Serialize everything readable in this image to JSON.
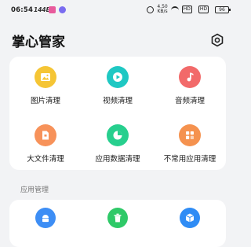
{
  "status_bar": {
    "time": "06:54",
    "net_speed": "144B",
    "net_rate_top": "4.50",
    "net_rate_bottom": "KB/s",
    "battery": "96"
  },
  "header": {
    "title": "掌心管家"
  },
  "tools": [
    {
      "label": "图片清理",
      "color": "#f5c535",
      "icon": "image-icon"
    },
    {
      "label": "视频清理",
      "color": "#1fc8c3",
      "icon": "play-icon"
    },
    {
      "label": "音频清理",
      "color": "#f26a6a",
      "icon": "music-note-icon"
    },
    {
      "label": "大文件清理",
      "color": "#f7925a",
      "icon": "file-icon"
    },
    {
      "label": "应用数据清理",
      "color": "#27cf8e",
      "icon": "pie-chart-icon"
    },
    {
      "label": "不常用应用清理",
      "color": "#f5924f",
      "icon": "apps-grid-icon"
    }
  ],
  "section": {
    "app_manage_label": "应用管理"
  },
  "manage_tools": [
    {
      "color": "#3d8ef5",
      "icon": "android-icon"
    },
    {
      "color": "#2fc968",
      "icon": "trash-icon"
    },
    {
      "color": "#2f8cf5",
      "icon": "package-icon"
    }
  ]
}
